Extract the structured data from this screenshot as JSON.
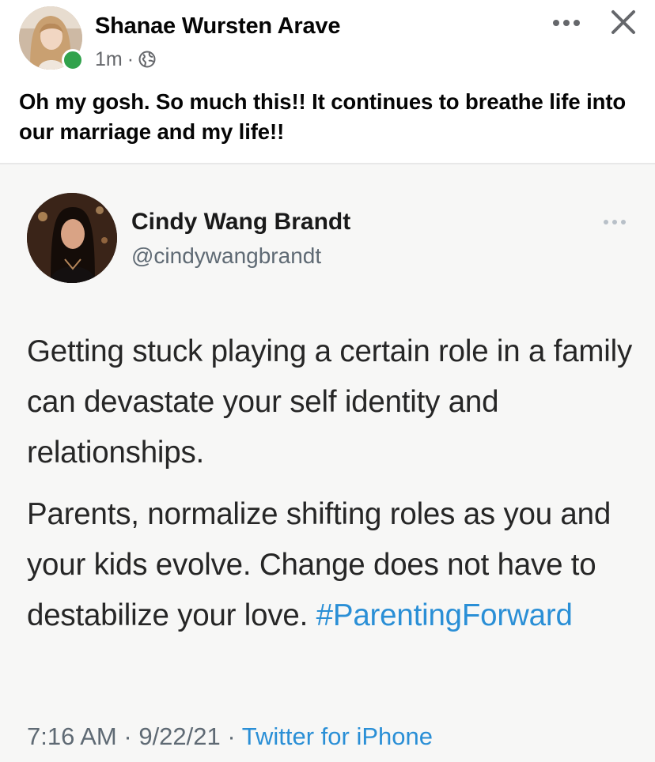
{
  "post": {
    "author": "Shanae Wursten Arave",
    "time": "1m",
    "separator": "·",
    "audience_icon": "globe-icon",
    "text": "Oh my gosh. So much this!! It continues to breathe life into our marriage and my life!!"
  },
  "header_actions": {
    "more_icon": "more-horizontal-icon",
    "close_icon": "close-icon"
  },
  "tweet": {
    "name": "Cindy Wang Brandt",
    "handle": "@cindywangbrandt",
    "paragraph1": "Getting stuck playing a certain role in a family can devastate your self identity and relationships.",
    "paragraph2_text": "Parents, normalize shifting roles as you and your kids evolve. Change does not have to destabilize your love.",
    "hashtag": "#ParentingForward",
    "time": "7:16 AM",
    "date": "9/22/21",
    "separator": "·",
    "source": "Twitter for iPhone"
  },
  "colors": {
    "online": "#31a24c",
    "link": "#2a8fd6",
    "muted": "#65676b"
  }
}
